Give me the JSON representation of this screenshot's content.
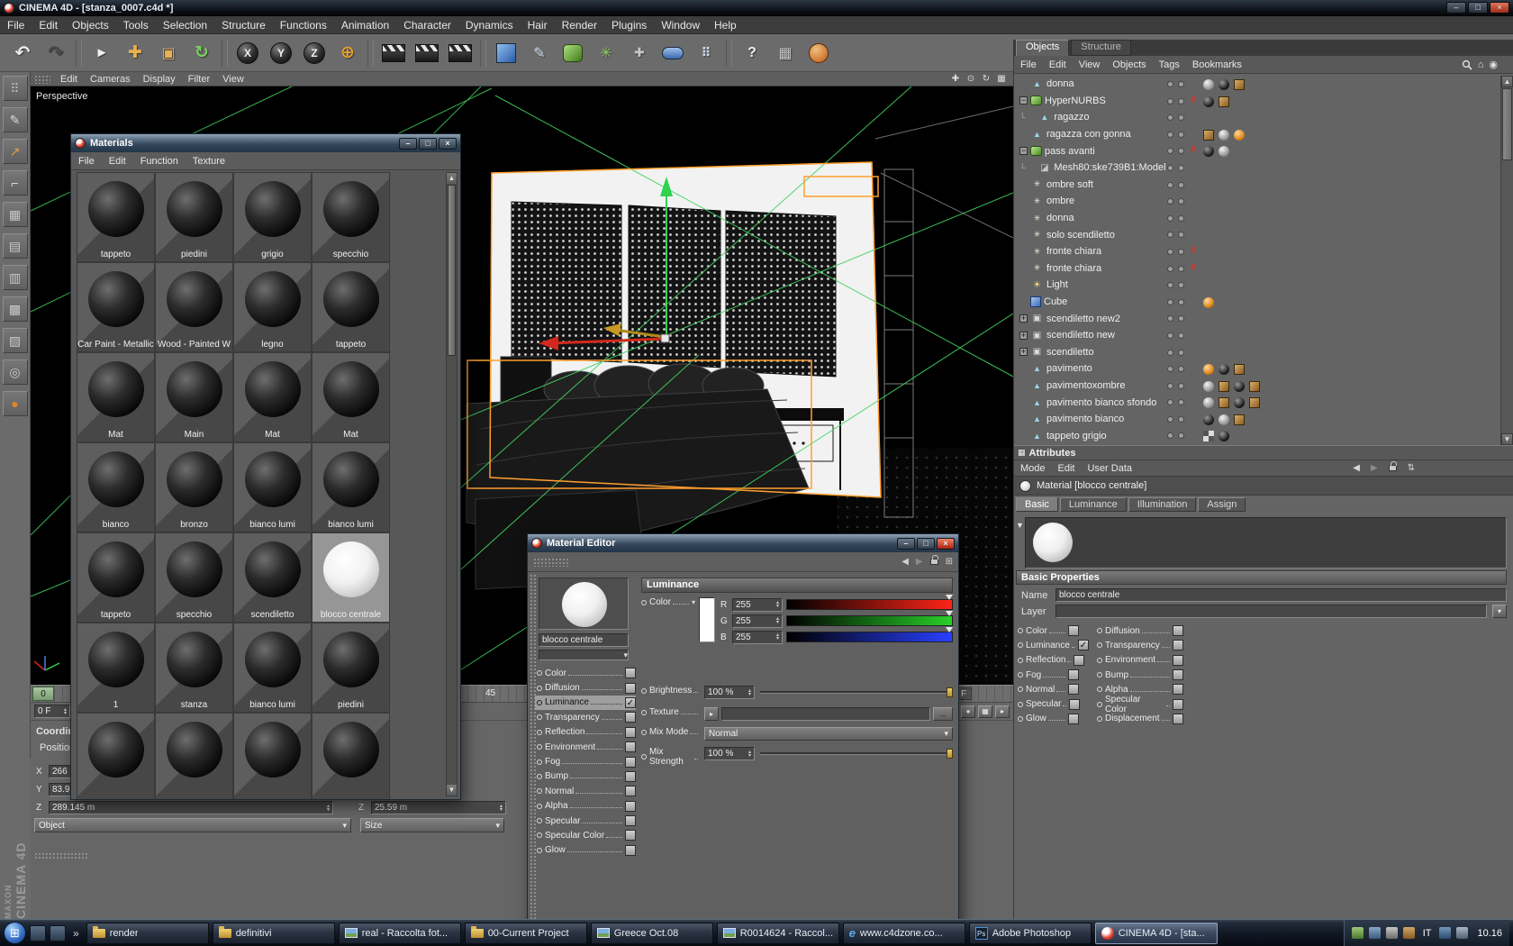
{
  "window": {
    "title": "CINEMA 4D - [stanza_0007.c4d *]"
  },
  "menubar": [
    "File",
    "Edit",
    "Objects",
    "Tools",
    "Selection",
    "Structure",
    "Functions",
    "Animation",
    "Character",
    "Dynamics",
    "Hair",
    "Render",
    "Plugins",
    "Window",
    "Help"
  ],
  "toolbar": [
    {
      "kind": "glyph",
      "name": "undo-button",
      "glyph": "↶",
      "color": "#ececec",
      "size": 20
    },
    {
      "kind": "glyph",
      "name": "redo-button",
      "glyph": "↷",
      "color": "#474747",
      "size": 20
    },
    {
      "kind": "sep"
    },
    {
      "kind": "glyph",
      "name": "live-selection-button",
      "glyph": "►",
      "color": "#f0f0f0",
      "size": 15
    },
    {
      "kind": "glyph",
      "name": "move-tool-button",
      "glyph": "✚",
      "color": "#e8b050",
      "size": 19
    },
    {
      "kind": "glyph",
      "name": "scale-tool-button",
      "glyph": "▣",
      "color": "#e8b050",
      "size": 16
    },
    {
      "kind": "glyph",
      "name": "rotate-tool-button",
      "glyph": "↻",
      "color": "#7ad060",
      "size": 19
    },
    {
      "kind": "sep"
    },
    {
      "kind": "orb",
      "name": "lock-x-axis-button",
      "letter": "X"
    },
    {
      "kind": "orb",
      "name": "lock-y-axis-button",
      "letter": "Y"
    },
    {
      "kind": "orb",
      "name": "lock-z-axis-button",
      "letter": "Z"
    },
    {
      "kind": "glyph",
      "name": "coordinate-system-button",
      "glyph": "⊕",
      "color": "#e8a030",
      "size": 19
    },
    {
      "kind": "sep"
    },
    {
      "kind": "clapper",
      "name": "render-view-button"
    },
    {
      "kind": "clapper",
      "name": "render-picture-viewer-button"
    },
    {
      "kind": "clapper",
      "name": "render-settings-button"
    },
    {
      "kind": "sep"
    },
    {
      "kind": "swatch",
      "name": "add-primitive-button",
      "shape": "square",
      "color": "linear-gradient(135deg,#8fc0f0,#2a5aa8)"
    },
    {
      "kind": "glyph",
      "name": "add-spline-button",
      "glyph": "✎",
      "color": "#cfe0f0",
      "size": 16
    },
    {
      "kind": "swatch",
      "name": "add-hypernurbs-button",
      "shape": "rounded",
      "color": "linear-gradient(135deg,#b0e080,#3f7a1a)"
    },
    {
      "kind": "glyph",
      "name": "add-array-button",
      "glyph": "✳",
      "color": "#8fd060",
      "size": 16
    },
    {
      "kind": "glyph",
      "name": "add-symmetry-button",
      "glyph": "✚",
      "color": "#c8c8c8",
      "size": 14
    },
    {
      "kind": "swatch",
      "name": "add-deformer-button",
      "shape": "capsule",
      "color": "linear-gradient(#9fc0e8,#3a6ab0)"
    },
    {
      "kind": "glyph",
      "name": "add-environment-button",
      "glyph": "⠿",
      "color": "#c8d8e8",
      "size": 14
    },
    {
      "kind": "sep"
    },
    {
      "kind": "glyph",
      "name": "help-button",
      "glyph": "?",
      "color": "#f0f0f0",
      "size": 16
    },
    {
      "kind": "glyph",
      "name": "snap-settings-button",
      "glyph": "▦",
      "color": "#c8c8c8",
      "size": 16
    },
    {
      "kind": "swatch",
      "name": "online-updater-button",
      "shape": "circle",
      "color": "radial-gradient(circle at 35% 30%,#f0c080,#c05a10)"
    }
  ],
  "left_toolbar": [
    {
      "glyph": "⠿",
      "color": "#b8b8b8"
    },
    {
      "glyph": "✎",
      "color": "#d8d8d8"
    },
    {
      "glyph": "↗",
      "color": "#e0a040"
    },
    {
      "glyph": "⌐",
      "color": "#d8d8d8"
    },
    {
      "glyph": "▦",
      "color": "#c8c8c8"
    },
    {
      "glyph": "▤",
      "color": "#c8c8c8"
    },
    {
      "glyph": "▥",
      "color": "#c8c8c8"
    },
    {
      "glyph": "▩",
      "color": "#c8c8c8"
    },
    {
      "glyph": "▨",
      "color": "#c8c8c8"
    },
    {
      "glyph": "◎",
      "color": "#c8c8c8"
    },
    {
      "glyph": "●",
      "color": "#e08828"
    }
  ],
  "viewport": {
    "menu": [
      "Edit",
      "Cameras",
      "Display",
      "Filter",
      "View"
    ],
    "label": "Perspective",
    "view_icons": [
      {
        "name": "pan-view-icon",
        "glyph": "✚"
      },
      {
        "name": "zoom-view-icon",
        "glyph": "⊙"
      },
      {
        "name": "rotate-view-icon",
        "glyph": "↻"
      },
      {
        "name": "toggle-views-icon",
        "glyph": "▦"
      }
    ]
  },
  "materials_window": {
    "title": "Materials",
    "menu": [
      "File",
      "Edit",
      "Function",
      "Texture"
    ],
    "items": [
      {
        "label": "tappeto"
      },
      {
        "label": "piedini"
      },
      {
        "label": "grigio"
      },
      {
        "label": "specchio"
      },
      {
        "label": "Car Paint - Metallic"
      },
      {
        "label": "Wood - Painted W"
      },
      {
        "label": "legno"
      },
      {
        "label": "tappeto"
      },
      {
        "label": "Mat"
      },
      {
        "label": "Main"
      },
      {
        "label": "Mat"
      },
      {
        "label": "Mat"
      },
      {
        "label": "bianco"
      },
      {
        "label": "bronzo"
      },
      {
        "label": "bianco lumi"
      },
      {
        "label": "bianco lumi"
      },
      {
        "label": "tappeto"
      },
      {
        "label": "specchio"
      },
      {
        "label": "scendiletto"
      },
      {
        "label": "blocco centrale",
        "white": true,
        "selected": true
      },
      {
        "label": "1"
      },
      {
        "label": "stanza"
      },
      {
        "label": "bianco lumi"
      },
      {
        "label": "piedini"
      },
      {
        "label": ""
      },
      {
        "label": ""
      },
      {
        "label": ""
      },
      {
        "label": ""
      }
    ]
  },
  "material_editor": {
    "title": "Material Editor",
    "preview_name": "blocco centrale",
    "channels": [
      {
        "label": "Color"
      },
      {
        "label": "Diffusion"
      },
      {
        "label": "Luminance",
        "checked": true,
        "selected": true
      },
      {
        "label": "Transparency"
      },
      {
        "label": "Reflection"
      },
      {
        "label": "Environment"
      },
      {
        "label": "Fog"
      },
      {
        "label": "Bump"
      },
      {
        "label": "Normal"
      },
      {
        "label": "Alpha"
      },
      {
        "label": "Specular"
      },
      {
        "label": "Specular Color"
      },
      {
        "label": "Glow"
      }
    ],
    "panel": {
      "header": "Luminance",
      "color_label": "Color",
      "rgb": [
        {
          "channel": "R",
          "value": "255",
          "gradient": "linear-gradient(to right,#000,#ff2418)"
        },
        {
          "channel": "G",
          "value": "255",
          "gradient": "linear-gradient(to right,#000,#28d028)"
        },
        {
          "channel": "B",
          "value": "255",
          "gradient": "linear-gradient(to right,#000,#2840ff)"
        }
      ],
      "brightness_label": "Brightness",
      "brightness_value": "100 %",
      "texture_label": "Texture",
      "texture_more": "...",
      "mix_mode_label": "Mix Mode",
      "mix_mode_value": "Normal",
      "mix_strength_label": "Mix Strength",
      "mix_strength_value": "100 %"
    }
  },
  "object_manager": {
    "tabs": [
      {
        "label": "Objects",
        "active": true
      },
      {
        "label": "Structure",
        "active": false
      }
    ],
    "menu": [
      "File",
      "Edit",
      "View",
      "Objects",
      "Tags",
      "Bookmarks"
    ],
    "tree": [
      {
        "label": "donna",
        "icon": "poly",
        "indent": 0,
        "tags": [
          "ball-gray",
          "ball-dark",
          "cube"
        ]
      },
      {
        "label": "HyperNURBS",
        "icon": "hn",
        "indent": 0,
        "expander": "-",
        "redx": true,
        "tags": [
          "ball-dark",
          "cube"
        ]
      },
      {
        "label": "ragazzo",
        "icon": "poly",
        "indent": 1
      },
      {
        "label": "ragazza con gonna",
        "icon": "poly",
        "indent": 0,
        "tags": [
          "cube",
          "ball-gray",
          "ball-orange"
        ]
      },
      {
        "label": "pass avanti",
        "icon": "hn",
        "indent": 0,
        "expander": "-",
        "redx": true,
        "tags": [
          "ball-dark",
          "ball-gray"
        ]
      },
      {
        "label": "Mesh80:ske739B1:Model",
        "icon": "mesh",
        "indent": 1
      },
      {
        "label": "ombre soft",
        "icon": "sel",
        "indent": 0
      },
      {
        "label": "ombre",
        "icon": "sel",
        "indent": 0
      },
      {
        "label": "donna",
        "icon": "sel",
        "indent": 0
      },
      {
        "label": "solo scendiletto",
        "icon": "sel",
        "indent": 0
      },
      {
        "label": "fronte chiara",
        "icon": "sel",
        "indent": 0,
        "redx": true
      },
      {
        "label": "fronte chiara",
        "icon": "sel",
        "indent": 0,
        "redx": true
      },
      {
        "label": "Light",
        "icon": "light",
        "indent": 0
      },
      {
        "label": "Cube",
        "icon": "cube",
        "indent": 0,
        "tags": [
          "ball-orange"
        ]
      },
      {
        "label": "scendiletto new2",
        "icon": "inst",
        "indent": 0,
        "expander": "+"
      },
      {
        "label": "scendiletto new",
        "icon": "inst",
        "indent": 0,
        "expander": "+"
      },
      {
        "label": "scendiletto",
        "icon": "inst",
        "indent": 0,
        "expander": "+"
      },
      {
        "label": "pavimento",
        "icon": "poly",
        "indent": 0,
        "tags": [
          "ball-orange",
          "ball-dark",
          "cube"
        ]
      },
      {
        "label": "pavimentoxombre",
        "icon": "poly",
        "indent": 0,
        "tags": [
          "ball-gray",
          "cube",
          "ball-dark",
          "cube"
        ]
      },
      {
        "label": "pavimento bianco sfondo",
        "icon": "poly",
        "indent": 0,
        "tags": [
          "ball-gray",
          "cube",
          "ball-dark",
          "cube"
        ]
      },
      {
        "label": "pavimento bianco",
        "icon": "poly",
        "indent": 0,
        "tags": [
          "ball-dark",
          "ball-gray",
          "cube"
        ]
      },
      {
        "label": "tappeto grigio",
        "icon": "poly",
        "indent": 0,
        "tags": [
          "checker",
          "ball-dark"
        ]
      }
    ]
  },
  "attributes": {
    "header": "Attributes",
    "menu": [
      "Mode",
      "Edit",
      "User Data"
    ],
    "object_label": "Material [blocco centrale]",
    "tabs": [
      {
        "label": "Basic",
        "active": true
      },
      {
        "label": "Luminance",
        "active": false
      },
      {
        "label": "Illumination",
        "active": false
      },
      {
        "label": "Assign",
        "active": false
      }
    ],
    "section": "Basic Properties",
    "name_label": "Name",
    "name_value": "blocco centrale",
    "layer_label": "Layer",
    "checks_left": [
      {
        "label": "Color",
        "checked": false
      },
      {
        "label": "Luminance",
        "checked": true
      },
      {
        "label": "Reflection",
        "checked": false
      },
      {
        "label": "Fog",
        "checked": false
      },
      {
        "label": "Normal",
        "checked": false
      },
      {
        "label": "Specular",
        "checked": false
      },
      {
        "label": "Glow",
        "checked": false
      }
    ],
    "checks_right": [
      {
        "label": "Diffusion",
        "checked": false
      },
      {
        "label": "Transparency",
        "checked": false
      },
      {
        "label": "Environment",
        "checked": false
      },
      {
        "label": "Bump",
        "checked": false
      },
      {
        "label": "Alpha",
        "checked": false
      },
      {
        "label": "Specular Color",
        "checked": false
      },
      {
        "label": "Displacement",
        "checked": false
      }
    ]
  },
  "timeline": {
    "ticks": [
      "0",
      "45"
    ],
    "end_label": "F",
    "frame_field": "0 F"
  },
  "coordinates": {
    "header": "Coordinates",
    "section": "Position",
    "x_label": "X",
    "x_value": "266",
    "y_label": "Y",
    "y_value": "83.9",
    "z_label": "Z",
    "z_value": "289.145 m",
    "z2_label": "Z",
    "z2_value": "25.59 m",
    "object_dropdown": "Object",
    "size_dropdown": "Size"
  },
  "branding": {
    "line1": "MAXON",
    "line2": "CINEMA 4D"
  },
  "taskbar": {
    "buttons": [
      {
        "label": "render",
        "icon": "folder"
      },
      {
        "label": "definitivi",
        "icon": "folder"
      },
      {
        "label": "real - Raccolta fot...",
        "icon": "image"
      },
      {
        "label": "00-Current Project",
        "icon": "folder"
      },
      {
        "label": "Greece Oct.08",
        "icon": "image"
      },
      {
        "label": "R0014624 - Raccol...",
        "icon": "image"
      },
      {
        "label": "www.c4dzone.co...",
        "icon": "ie"
      },
      {
        "label": "Adobe Photoshop",
        "icon": "ps"
      },
      {
        "label": "CINEMA 4D - [sta...",
        "icon": "c4d",
        "active": true
      }
    ],
    "lang": "IT",
    "time": "10.16"
  }
}
